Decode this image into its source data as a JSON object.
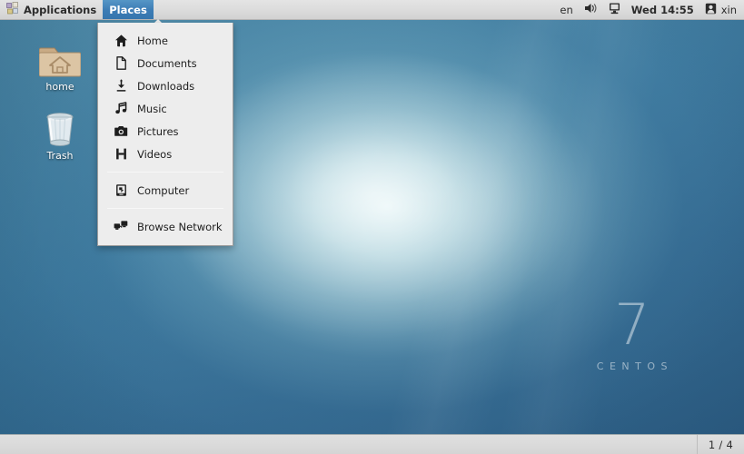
{
  "top_panel": {
    "applications_label": "Applications",
    "applications_icon": "applications-icon",
    "places_label": "Places",
    "tray": {
      "keyboard_layout": "en",
      "volume_icon": "volume-icon",
      "display_icon": "display-icon",
      "clock": "Wed 14:55",
      "user_icon": "user-icon",
      "username": "xin"
    }
  },
  "places_menu": {
    "items": [
      {
        "label": "Home",
        "icon": "home-icon"
      },
      {
        "label": "Documents",
        "icon": "documents-icon"
      },
      {
        "label": "Downloads",
        "icon": "downloads-icon"
      },
      {
        "label": "Music",
        "icon": "music-icon"
      },
      {
        "label": "Pictures",
        "icon": "pictures-icon"
      },
      {
        "label": "Videos",
        "icon": "videos-icon"
      },
      {
        "label": "Computer",
        "icon": "computer-icon"
      },
      {
        "label": "Browse Network",
        "icon": "network-icon"
      }
    ]
  },
  "desktop": {
    "icons": [
      {
        "label": "home",
        "icon": "home-folder-icon"
      },
      {
        "label": "Trash",
        "icon": "trash-icon"
      }
    ],
    "branding": {
      "version": "7",
      "name": "CENTOS"
    }
  },
  "bottom_panel": {
    "workspace_indicator": "1 / 4"
  },
  "colors": {
    "panel_bg": "#dedede",
    "menu_highlight": "#3c7cb5",
    "menu_bg": "#ededed",
    "wallpaper_center": "#cfe6e6",
    "wallpaper_edge": "#2e6087",
    "text": "#2b2b2b"
  }
}
